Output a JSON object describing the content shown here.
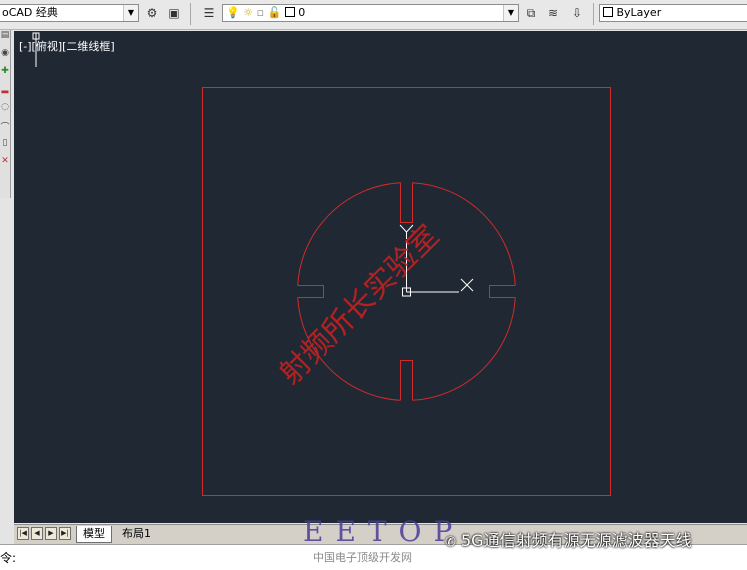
{
  "toolbar": {
    "workspace": "oCAD 经典",
    "layer": "0",
    "color": "ByLayer"
  },
  "viewport": {
    "label": "[-][俯视][二维线框]",
    "watermark_diagonal": "射频所长实验室"
  },
  "tabs": {
    "model": "模型",
    "layout1": "布局1"
  },
  "command": {
    "prompt": "令:"
  },
  "overlay": {
    "brand": "EETOP",
    "brand_sub": "中国电子顶级开发网",
    "channel": "5G通信射频有源无源滤波器天线"
  },
  "colors": {
    "drawing": "#d42a2a",
    "canvas": "#202833",
    "cursor": "#ffffff"
  }
}
